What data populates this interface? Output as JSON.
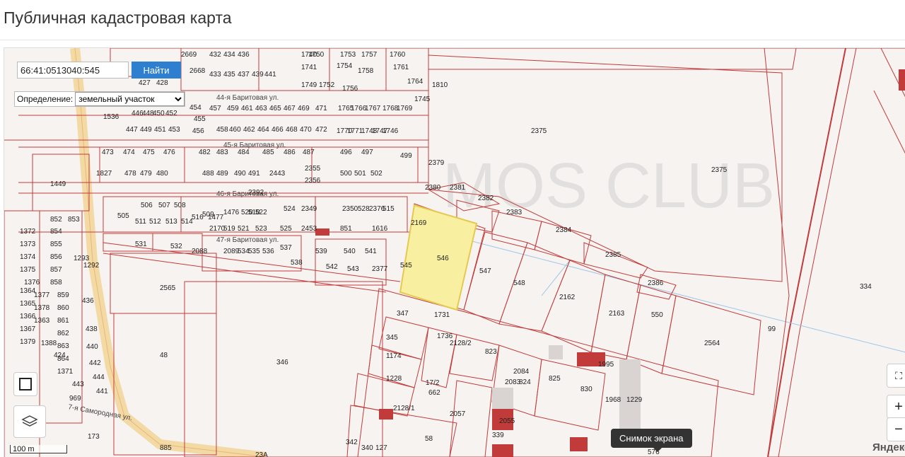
{
  "page": {
    "title": "Публичная кадастровая карта"
  },
  "search": {
    "value": "66:41:0513040:545",
    "button_label": "Найти"
  },
  "definition": {
    "label": "Определение:",
    "selected": "земельный участок"
  },
  "map": {
    "streets": [
      "44-я Баритовая ул.",
      "45-я Баритовая ул.",
      "46-я Баритовая ул.",
      "47-я Баритовая ул.",
      "7-я Самородная ул."
    ],
    "highlighted_parcel": "545",
    "parcel_labels": [
      "2669",
      "432",
      "434",
      "436",
      "1740",
      "1750",
      "1753",
      "1757",
      "1760",
      "1761",
      "1764",
      "1810",
      "1745",
      "2375",
      "2375",
      "2668",
      "433",
      "435",
      "437",
      "439",
      "441",
      "1741",
      "1749",
      "1752",
      "1754",
      "1758",
      "1756",
      "427",
      "428",
      "446",
      "448",
      "450",
      "452",
      "454",
      "455",
      "456",
      "457",
      "459",
      "461",
      "463",
      "465",
      "467",
      "469",
      "471",
      "1765",
      "1766",
      "1767",
      "1768",
      "1769",
      "1746",
      "1747",
      "1748",
      "1770",
      "1771",
      "1536",
      "447",
      "449",
      "451",
      "453",
      "458",
      "460",
      "462",
      "464",
      "466",
      "468",
      "470",
      "472",
      "473",
      "474",
      "475",
      "476",
      "482",
      "483",
      "484",
      "485",
      "486",
      "487",
      "496",
      "497",
      "499",
      "1827",
      "478",
      "479",
      "480",
      "488",
      "489",
      "490",
      "491",
      "2443",
      "2355",
      "2356",
      "500",
      "501",
      "502",
      "2379",
      "2380",
      "2381",
      "2382",
      "2383",
      "2384",
      "2385",
      "2386",
      "1449",
      "2392",
      "505",
      "506",
      "507",
      "508",
      "509",
      "510",
      "511",
      "512",
      "513",
      "514",
      "516",
      "1477",
      "1476",
      "520",
      "522",
      "524",
      "2349",
      "2350",
      "528",
      "2376",
      "515",
      "2169",
      "2170",
      "519",
      "521",
      "523",
      "525",
      "2453",
      "851",
      "1616",
      "852",
      "853",
      "854",
      "855",
      "856",
      "857",
      "858",
      "859",
      "860",
      "861",
      "862",
      "863",
      "864",
      "1371",
      "1372",
      "1373",
      "1374",
      "1375",
      "1376",
      "1377",
      "1378",
      "1363",
      "1364",
      "1365",
      "1366",
      "1367",
      "1379",
      "1388",
      "424",
      "1293",
      "1292",
      "436",
      "438",
      "440",
      "442",
      "444",
      "441",
      "443",
      "969",
      "531",
      "532",
      "2088",
      "2089",
      "534",
      "535",
      "536",
      "537",
      "538",
      "539",
      "540",
      "541",
      "542",
      "543",
      "2377",
      "545",
      "546",
      "547",
      "548",
      "2162",
      "2163",
      "550",
      "2564",
      "2565",
      "48",
      "346",
      "347",
      "345",
      "1174",
      "1731",
      "1736",
      "2128/2",
      "823",
      "2084",
      "2083",
      "824",
      "825",
      "830",
      "1968",
      "1995",
      "1229",
      "1228",
      "662",
      "2128/1",
      "2057",
      "2055",
      "339",
      "342",
      "340",
      "127",
      "58",
      "99",
      "334",
      "173",
      "576",
      "885",
      "17",
      "23А",
      "17/2"
    ]
  },
  "controls": {
    "fullscreen_icon": "fullscreen-icon",
    "zoom_in": "+",
    "zoom_out": "−",
    "layers_icon": "layers-icon",
    "ruler_icon": "ruler-icon"
  },
  "tooltip": "Снимок экрана",
  "scale_label": "100 m",
  "provider": "Яндекс",
  "watermark": "MOS CLUB",
  "colors": {
    "parcel_stroke": "#c23b3b",
    "highlight_fill": "#f8efa0",
    "road_fill": "#f3dcb0",
    "button": "#2f7fd0"
  }
}
